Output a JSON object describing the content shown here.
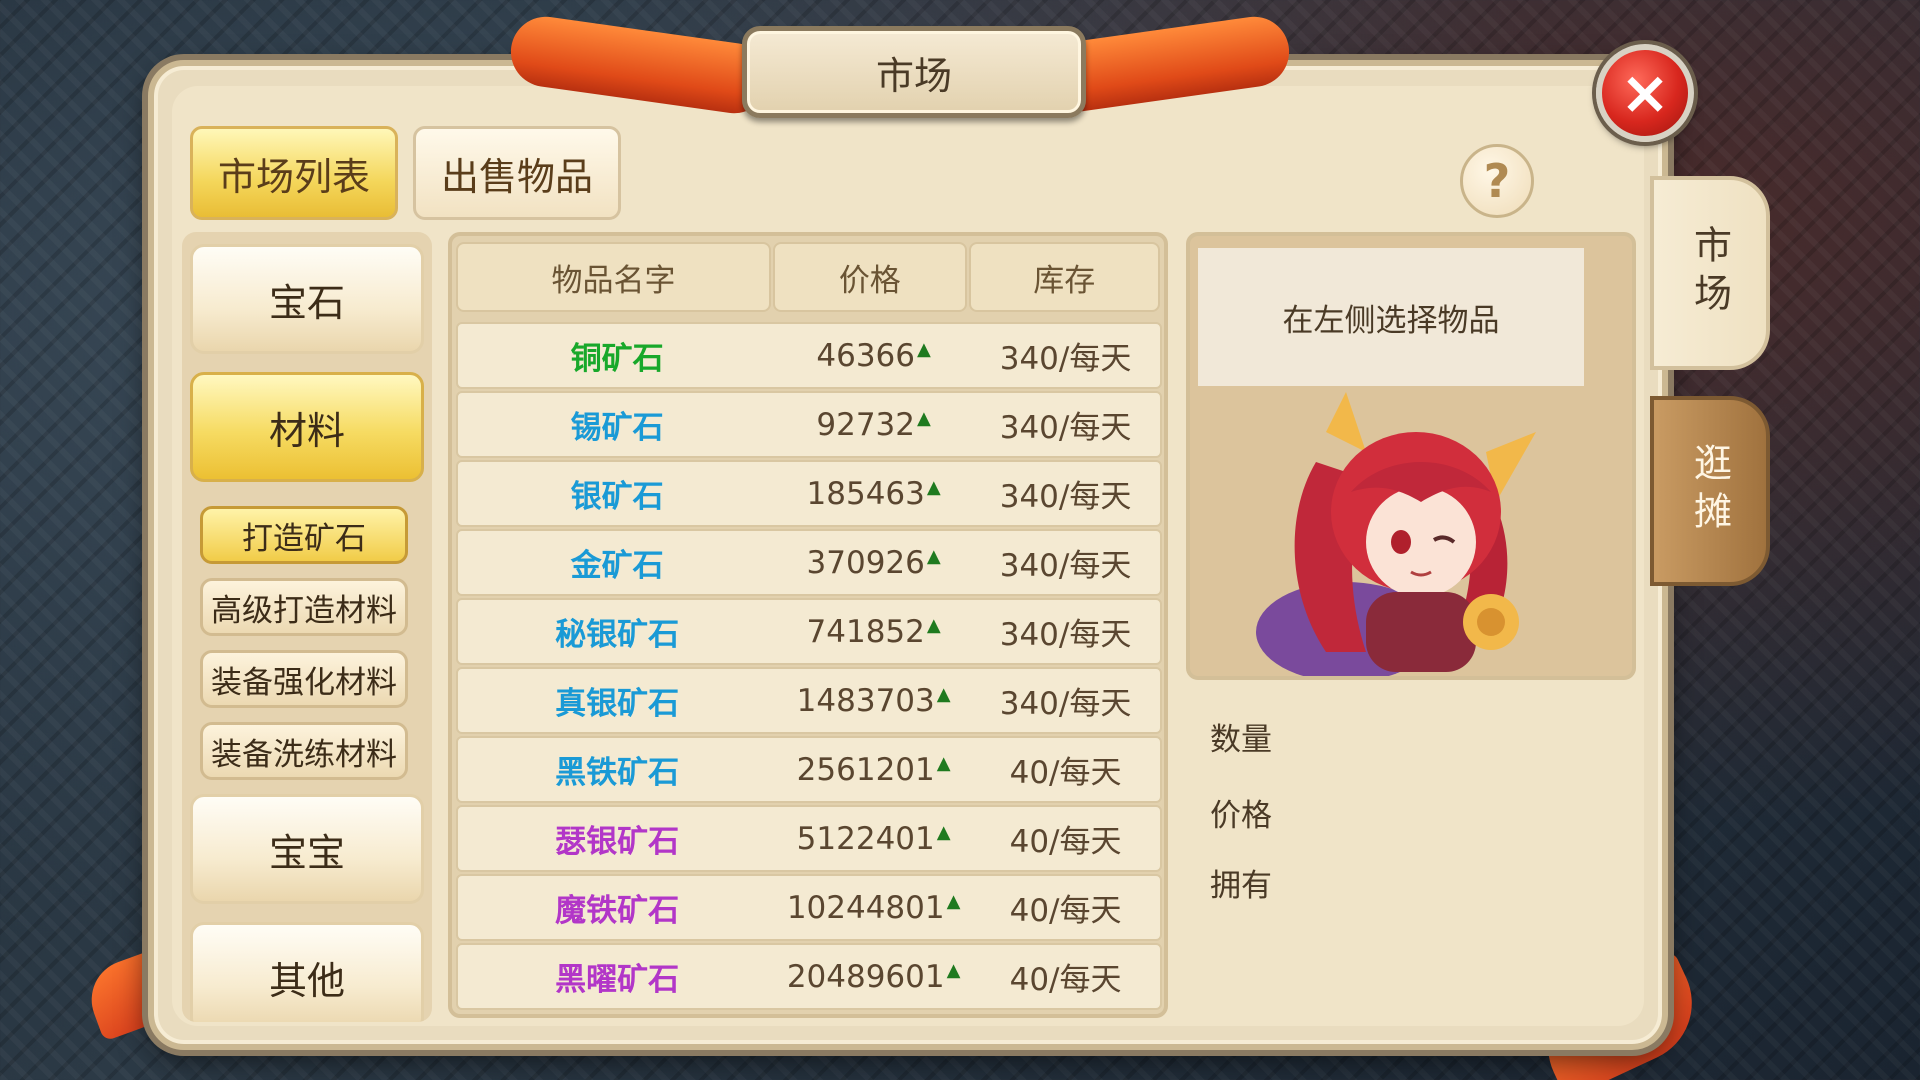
{
  "title": "市场",
  "close_icon": "×",
  "help_icon": "?",
  "top_tabs": [
    {
      "label": "市场列表",
      "active": true
    },
    {
      "label": "出售物品",
      "active": false
    }
  ],
  "side_tabs": [
    {
      "label": "市场",
      "active": true
    },
    {
      "label": "逛摊",
      "active": false
    }
  ],
  "categories": [
    {
      "label": "宝石",
      "active": false
    },
    {
      "label": "材料",
      "active": true
    },
    {
      "label": "宝宝",
      "active": false
    },
    {
      "label": "其他",
      "active": false
    }
  ],
  "subcategories": [
    {
      "label": "打造矿石",
      "active": true
    },
    {
      "label": "高级打造材料",
      "active": false
    },
    {
      "label": "装备强化材料",
      "active": false
    },
    {
      "label": "装备洗练材料",
      "active": false
    }
  ],
  "table": {
    "headers": [
      "物品名字",
      "价格",
      "库存"
    ],
    "trend_icon": "▲",
    "rows": [
      {
        "name": "铜矿石",
        "price": "46366",
        "stock": "340/每天",
        "color": "#18a82a"
      },
      {
        "name": "锡矿石",
        "price": "92732",
        "stock": "340/每天",
        "color": "#1a9ad6"
      },
      {
        "name": "银矿石",
        "price": "185463",
        "stock": "340/每天",
        "color": "#1a9ad6"
      },
      {
        "name": "金矿石",
        "price": "370926",
        "stock": "340/每天",
        "color": "#1a9ad6"
      },
      {
        "name": "秘银矿石",
        "price": "741852",
        "stock": "340/每天",
        "color": "#1a9ad6"
      },
      {
        "name": "真银矿石",
        "price": "1483703",
        "stock": "340/每天",
        "color": "#1a9ad6"
      },
      {
        "name": "黑铁矿石",
        "price": "2561201",
        "stock": "40/每天",
        "color": "#1a9ad6"
      },
      {
        "name": "瑟银矿石",
        "price": "5122401",
        "stock": "40/每天",
        "color": "#b236c8"
      },
      {
        "name": "魔铁矿石",
        "price": "10244801",
        "stock": "40/每天",
        "color": "#b236c8"
      },
      {
        "name": "黑曜矿石",
        "price": "20489601",
        "stock": "40/每天",
        "color": "#b236c8"
      }
    ]
  },
  "detail": {
    "hint": "在左侧选择物品",
    "labels": {
      "quantity": "数量",
      "price": "价格",
      "owned": "拥有"
    }
  },
  "colors": {
    "accent_gold": "#f4d65a",
    "close_red": "#d8271e",
    "trend_green": "#1f7a1f"
  }
}
